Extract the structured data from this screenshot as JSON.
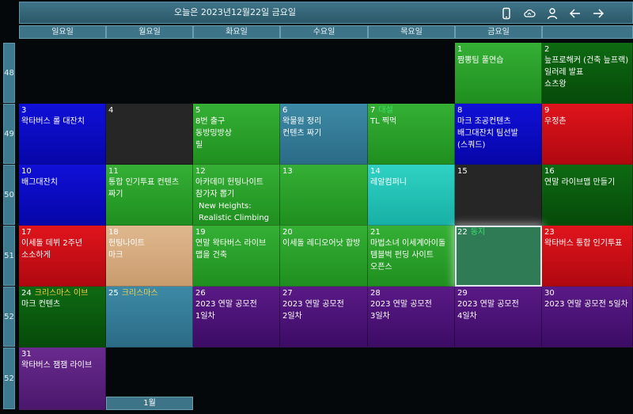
{
  "header": {
    "title": "오늘은 2023년12월22일 금요일",
    "icons": [
      "phone-icon",
      "cloud-sync-icon",
      "user-icon",
      "arrow-left-icon",
      "arrow-right-icon"
    ]
  },
  "weekdays": [
    "일요일",
    "월요일",
    "화요일",
    "수요일",
    "목요일",
    "금요일",
    ""
  ],
  "weeks": [
    "48",
    "49",
    "50",
    "51",
    "52",
    "52"
  ],
  "days": {
    "d1": {
      "num": "1",
      "events": [
        "짬뽕팀 풀연습"
      ]
    },
    "d2": {
      "num": "2",
      "events": [
        "늪프로해커 (건축 늪프랙)",
        "일러레 발표",
        "쇼츠왕"
      ]
    },
    "d3": {
      "num": "3",
      "events": [
        "왁타버스 롤 대잔치"
      ]
    },
    "d4": {
      "num": "4",
      "events": []
    },
    "d5": {
      "num": "5",
      "events": [
        "8번 출구",
        "동방밍방상",
        "릴"
      ]
    },
    "d6": {
      "num": "6",
      "events": [
        "왁물원 정리",
        "컨텐츠 짜기"
      ]
    },
    "d7": {
      "num": "7",
      "tag": "대설",
      "events": [
        "TL 찍먹"
      ]
    },
    "d8": {
      "num": "8",
      "events": [
        "마크 조공컨텐츠",
        "배그대잔치 팀선발",
        "(스쿼드)"
      ]
    },
    "d9": {
      "num": "9",
      "events": [
        "우정촌"
      ]
    },
    "d10": {
      "num": "10",
      "events": [
        "배그대잔치"
      ]
    },
    "d11": {
      "num": "11",
      "events": [
        "통합 인기투표 컨텐츠 짜기"
      ]
    },
    "d12": {
      "num": "12",
      "events": [
        "아카데미 헌팅나이트 참가자 뽑기",
        "New Heights: Realistic Climbing"
      ]
    },
    "d13": {
      "num": "13",
      "events": []
    },
    "d14": {
      "num": "14",
      "events": [
        "레알컴퍼니"
      ]
    },
    "d15": {
      "num": "15",
      "events": []
    },
    "d16": {
      "num": "16",
      "events": [
        "연말 라이브맵 만들기"
      ]
    },
    "d17": {
      "num": "17",
      "events": [
        "이세돌 데뷔 2주년 소소하게"
      ]
    },
    "d18": {
      "num": "18",
      "events": [
        "헌팅나이트",
        "마크"
      ]
    },
    "d19": {
      "num": "19",
      "events": [
        "연말 왁타버스 라이브 맵을 건축"
      ]
    },
    "d20": {
      "num": "20",
      "events": [
        "이세돌 레디오어낫 합방"
      ]
    },
    "d21": {
      "num": "21",
      "events": [
        "마법소녀 이세계아이돌 템블벅 펀딩 사이트 오픈스"
      ]
    },
    "d22": {
      "num": "22",
      "tag": "동지",
      "events": []
    },
    "d23": {
      "num": "23",
      "events": [
        "왁타버스 통합 인기투표"
      ]
    },
    "d24": {
      "num": "24",
      "tag": "크리스마스 이브",
      "events": [
        "마크 컨텐츠"
      ]
    },
    "d25": {
      "num": "25",
      "tag": "크리스마스",
      "events": []
    },
    "d26": {
      "num": "26",
      "events": [
        "2023 연말 공모전 1일차"
      ]
    },
    "d27": {
      "num": "27",
      "events": [
        "2023 연말 공모전 2일차"
      ]
    },
    "d28": {
      "num": "28",
      "events": [
        "2023 연말 공모전 3일차"
      ]
    },
    "d29": {
      "num": "29",
      "events": [
        "2023 연말 공모전 4일차"
      ]
    },
    "d30": {
      "num": "30",
      "events": [
        "2023 연말 공모전 5일차"
      ]
    },
    "d31": {
      "num": "31",
      "events": [
        "왁타버스 잼잼 라이브"
      ]
    }
  },
  "footer": {
    "next_month": "1월"
  }
}
